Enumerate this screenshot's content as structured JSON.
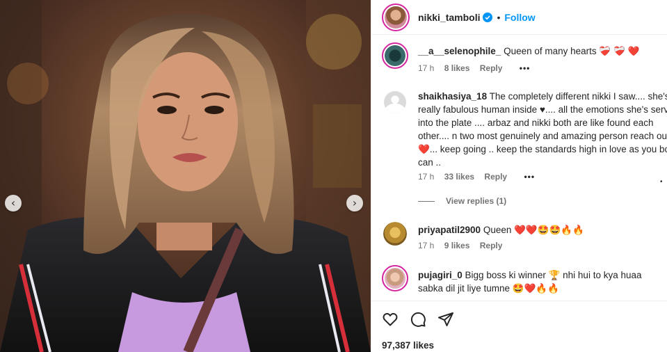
{
  "post": {
    "author": "nikki_tamboli",
    "follow_label": "Follow",
    "separator": "•",
    "likes_count": "97,387 likes",
    "image_description": "",
    "nav_prev": "‹",
    "nav_next": "›"
  },
  "comments": [
    {
      "user": "__a__selenophile_",
      "text": "Queen of many hearts ❤️‍🩹 ❤️‍🩹 ❤️",
      "time": "17 h",
      "likes": "8 likes",
      "reply": "Reply",
      "more": "•••"
    },
    {
      "user": "shaikhasiya_18",
      "text": "The completely different nikki I saw.... she's really fabulous human inside ♥.... all the emotions she's served into the plate .... arbaz and nikki both are like found each other.... n two most genuinely and amazing person reach out ❤️... keep going .. keep the standards high in love as you both can ..",
      "time": "17 h",
      "likes": "33 likes",
      "reply": "Reply",
      "more": "•••",
      "view_replies": "View replies (1)"
    },
    {
      "user": "priyapatil2900",
      "text": "Queen ❤️❤️🤩🤩🔥🔥",
      "time": "17 h",
      "likes": "9 likes",
      "reply": "Reply"
    },
    {
      "user": "pujagiri_0",
      "text": "Bigg boss ki winner 🏆 nhi hui to kya huaa sabka dil jit liye tumne 🤩❤️🔥🔥"
    }
  ],
  "stray_dot": "•",
  "colors": {
    "accent": "#0095f6",
    "text": "#262626",
    "muted": "#737373",
    "heart": "#ed1c3a",
    "ring": "#d6249f"
  },
  "icons": [
    "chevron-left-icon",
    "chevron-right-icon",
    "verified-icon",
    "heart-icon",
    "comment-icon",
    "share-icon",
    "more-icon"
  ]
}
